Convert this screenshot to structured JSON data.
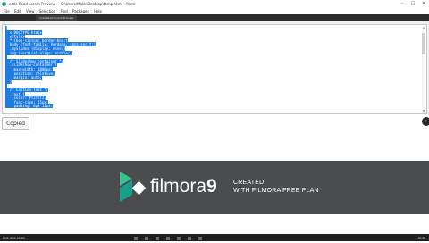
{
  "window": {
    "title": "code Read Lorem Preview — C:\\Users\\Malik\\Desktop\\temp.html - Atom",
    "controls": [
      "–",
      "□",
      "✕"
    ]
  },
  "menu": [
    "File",
    "Edit",
    "View",
    "Selection",
    "Find",
    "Packages",
    "Help"
  ],
  "tab": {
    "label": "code Read Lorem Preview"
  },
  "editor": {
    "lines": [
      "{",
      "  <!DOCTYPE html>",
      "  <style>",
      "  * {box-sizing: border-box;}",
      "  body {font-family: Verdana, sans-serif;}",
      "  .mySlides {display: none;}",
      "  img {vertical-align: middle;}",
      "",
      "  /* Slideshow container */",
      "  .slideshow-container {",
      "    max-width: 1000px;",
      "    position: relative;",
      "    margin: auto;",
      "  }",
      "",
      "  /* Caption text */",
      "  .text {",
      "    color: #f2f2f2;",
      "    font-size: 15px;",
      "    padding: 8px 12px;"
    ]
  },
  "copied_button": {
    "label": "Copied"
  },
  "side_button": {
    "label": "›"
  },
  "banner": {
    "brand": "filmora",
    "version": "9",
    "line1": "CREATED",
    "line2": "WITH FILMORA FREE PLAN",
    "colors": {
      "background": "#4a4c4e",
      "logo_green": "#33c290",
      "logo_teal": "#1a9e8c"
    }
  },
  "taskbar": {
    "start_text": "Look Give Lorem",
    "tray_time": "10:48"
  },
  "colors": {
    "selection": "#1e7be0"
  }
}
